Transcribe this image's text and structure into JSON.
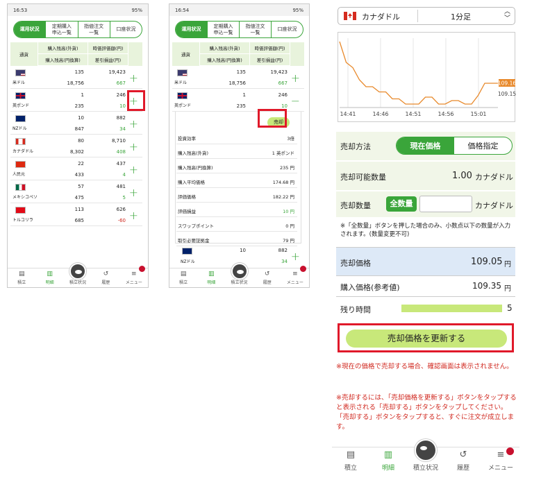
{
  "phones": [
    {
      "time": "16:53",
      "status": "95%"
    },
    {
      "time": "16:54",
      "status": "95%"
    }
  ],
  "tabs": [
    "運用状況",
    "定期購入\n申込一覧",
    "指値注文\n一覧",
    "口座状況"
  ],
  "table_header": {
    "currency": "通貨",
    "col1_top": "購入残高(外貨)",
    "col1_bottom": "購入残高(円換算)",
    "col2_top": "時価評価額(円)",
    "col2_bottom": "差引損益(円)"
  },
  "rows": [
    {
      "name": "米ドル",
      "flag": "us",
      "fx": "135",
      "jpy": "18,756",
      "value": "19,423",
      "pl": "667",
      "pl_color": "green"
    },
    {
      "name": "英ポンド",
      "flag": "uk",
      "fx": "1",
      "jpy": "235",
      "value": "246",
      "pl": "10",
      "pl_color": "green"
    },
    {
      "name": "NZドル",
      "flag": "nz",
      "fx": "10",
      "jpy": "847",
      "value": "882",
      "pl": "34",
      "pl_color": "green"
    },
    {
      "name": "カナダドル",
      "flag": "ca",
      "fx": "80",
      "jpy": "8,302",
      "value": "8,710",
      "pl": "408",
      "pl_color": "green"
    },
    {
      "name": "人民元",
      "flag": "cn",
      "fx": "22",
      "jpy": "433",
      "value": "437",
      "pl": "4",
      "pl_color": "green"
    },
    {
      "name": "メキシコペソ",
      "flag": "mx",
      "fx": "57",
      "jpy": "475",
      "value": "481",
      "pl": "5",
      "pl_color": "green"
    },
    {
      "name": "トルコリラ",
      "flag": "tr",
      "fx": "113",
      "jpy": "685",
      "value": "626",
      "pl": "-60",
      "pl_color": "red"
    }
  ],
  "sell_chip": "売却",
  "detail": [
    {
      "label": "投資効率",
      "value": "3倍"
    },
    {
      "label": "購入残高(外貨)",
      "value": "1 英ポンド"
    },
    {
      "label": "購入残高(円換算)",
      "value": "235 円"
    },
    {
      "label": "購入平均価格",
      "value": "174.68 円"
    },
    {
      "label": "評価価格",
      "value": "182.22 円"
    },
    {
      "label": "評価損益",
      "value": "10 円"
    },
    {
      "label": "スワップポイント",
      "value": "0 円"
    },
    {
      "label": "取引必要証拠金",
      "value": "79 円"
    }
  ],
  "nz_partial": {
    "name": "NZドル",
    "fx": "10",
    "value": "882",
    "jpy": "847",
    "pl": "34"
  },
  "nav": [
    "積立",
    "明細",
    "積立状況",
    "履歴",
    "メニュー"
  ],
  "right": {
    "currency": "カナダドル",
    "interval": "1分足",
    "chart_data": {
      "type": "line",
      "x": [
        "14:41",
        "14:46",
        "14:51",
        "14:56",
        "15:01"
      ],
      "values": [
        109.4,
        109.28,
        109.25,
        109.18,
        109.14,
        109.14,
        109.11,
        109.11,
        109.07,
        109.07,
        109.04,
        109.04,
        109.04,
        109.08,
        109.08,
        109.04,
        109.04,
        109.06,
        109.06,
        109.04,
        109.04,
        109.09,
        109.16,
        109.16,
        109.16
      ],
      "current_label": "109.16",
      "ref_label": "109.15",
      "line_color": "#e8892b"
    },
    "sell_method_label": "売却方法",
    "sell_method_active": "現在価格",
    "sell_method_other": "価格指定",
    "available_label": "売却可能数量",
    "available_value": "1.00",
    "unit": "カナダドル",
    "qty_label": "売却数量",
    "all_qty_btn": "全数量",
    "qty_value": "",
    "qty_note": "※「全数量」ボタンを押した場合のみ、小数点以下の数量が入力されます。(数量変更不可)",
    "sell_price_label": "売却価格",
    "sell_price_value": "109.05",
    "yen": "円",
    "buy_price_label": "購入価格(参考値)",
    "buy_price_value": "109.35",
    "remaining_label": "残り時間",
    "remaining_value": "5",
    "remaining_fraction": 1.0,
    "update_btn": "売却価格を更新する",
    "note1": "※現在の価格で売却する場合、確認画面は表示されません。",
    "note2": "※売却するには、「売却価格を更新する」ボタンをタップすると表示される「売却する」ボタンをタップしてください。「売却する」ボタンをタップすると、すぐに注文が成立します。"
  },
  "colors": {
    "green": "#3aa53a",
    "red": "#d0271e",
    "highlight": "#e0192a",
    "chart": "#e8892b"
  }
}
